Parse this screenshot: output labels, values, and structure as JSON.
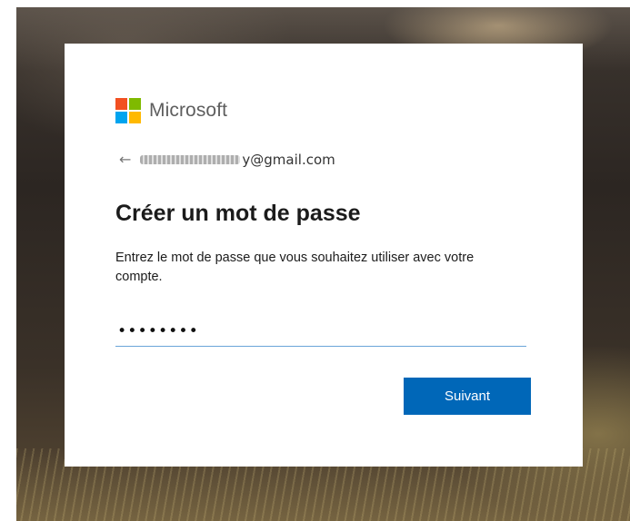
{
  "brand": {
    "name": "Microsoft",
    "logo_colors": [
      "#f25022",
      "#7fba00",
      "#00a4ef",
      "#ffb900"
    ]
  },
  "identity": {
    "back_icon": "←",
    "email_visible": "y@gmail.com"
  },
  "page": {
    "title": "Créer un mot de passe",
    "description": "Entrez le mot de passe que vous souhaitez utiliser avec votre compte."
  },
  "password_field": {
    "value": "••••••••"
  },
  "actions": {
    "next_label": "Suivant"
  },
  "colors": {
    "accent": "#0067b8",
    "input_underline": "#6aa4d8"
  }
}
